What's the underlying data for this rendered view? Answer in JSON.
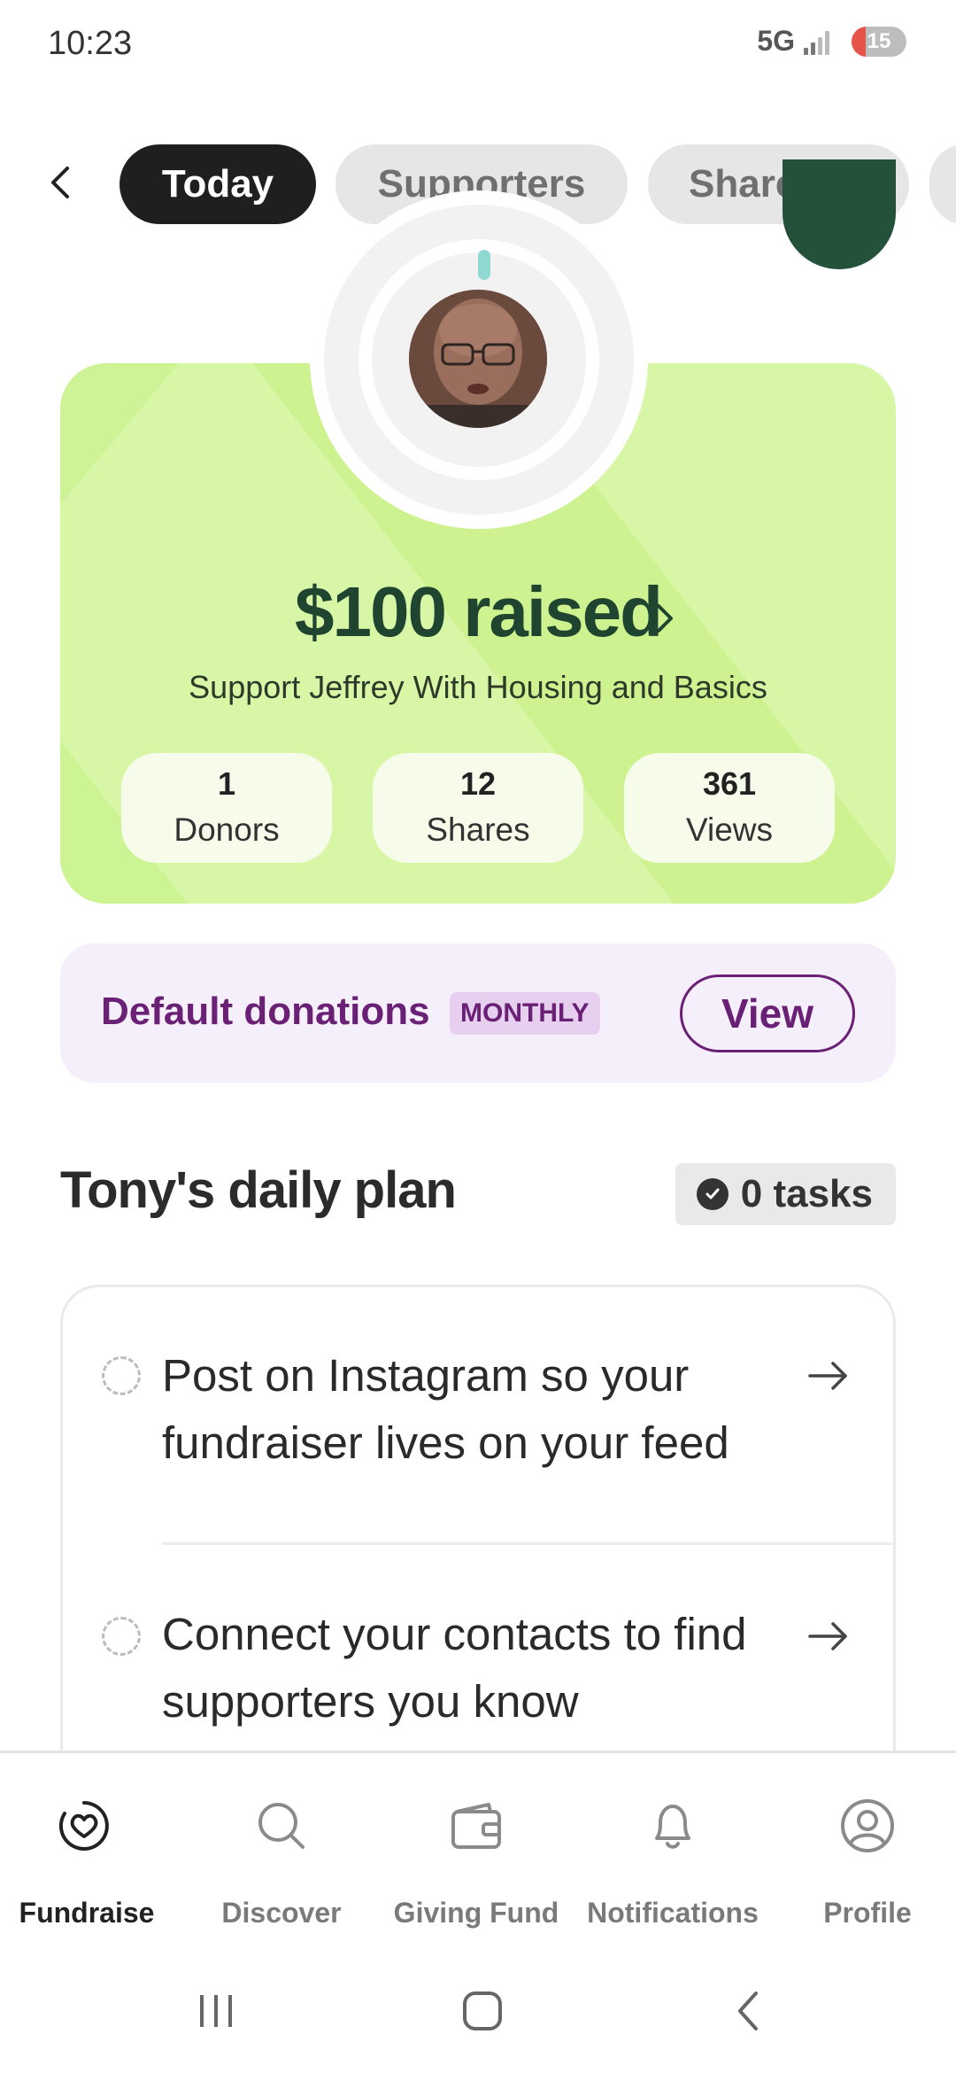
{
  "status_bar": {
    "time": "10:23",
    "network": "5G",
    "battery": "15"
  },
  "tabs": [
    {
      "label": "Today",
      "active": true
    },
    {
      "label": "Supporters",
      "active": false
    },
    {
      "label": "Sharehub",
      "active": false
    }
  ],
  "hero": {
    "raised": "$100 raised",
    "subtitle": "Support Jeffrey With Housing and Basics",
    "stats": [
      {
        "value": "1",
        "label": "Donors"
      },
      {
        "value": "12",
        "label": "Shares"
      },
      {
        "value": "361",
        "label": "Views"
      }
    ]
  },
  "donations": {
    "title": "Default donations",
    "badge": "MONTHLY",
    "button": "View"
  },
  "plan": {
    "title": "Tony's daily plan",
    "tasks_badge": "0 tasks",
    "tasks": [
      {
        "line1": "Post on Instagram so your",
        "line2": "fundraiser lives on your feed"
      },
      {
        "line1": "Connect your contacts to find",
        "line2": "supporters you know"
      }
    ]
  },
  "bottom_nav": [
    {
      "label": "Fundraise",
      "icon": "heart-circle-icon",
      "active": true
    },
    {
      "label": "Discover",
      "icon": "search-icon",
      "active": false
    },
    {
      "label": "Giving Fund",
      "icon": "wallet-icon",
      "active": false
    },
    {
      "label": "Notifications",
      "icon": "bell-icon",
      "active": false
    },
    {
      "label": "Profile",
      "icon": "profile-icon",
      "active": false
    }
  ],
  "colors": {
    "hero_bg": "#d7f7a7",
    "hero_text": "#1f4531",
    "donations_bg": "#f5eefb",
    "donations_accent": "#6a2175",
    "active_tab": "#1f1f1f"
  }
}
